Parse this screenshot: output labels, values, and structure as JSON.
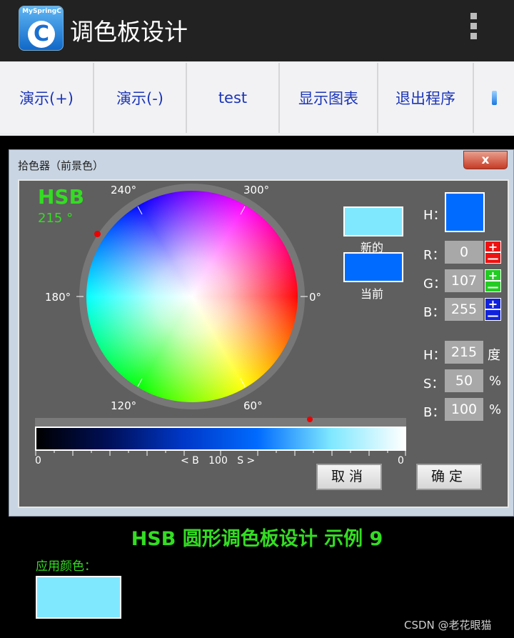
{
  "app": {
    "logo_text": "MySpringC",
    "logo_letter": "C",
    "title": "调色板设计",
    "overflow_icon": "overflow-menu-icon"
  },
  "toolbar": {
    "buttons": [
      "演示(+)",
      "演示(-)",
      "test",
      "显示图表",
      "退出程序"
    ]
  },
  "dialog": {
    "title": "拾色器（前景色）",
    "close_label": "x",
    "wheel": {
      "mode_label": "HSB",
      "hue_readout": "215 °",
      "angles": {
        "a240": "240°",
        "a300": "300°",
        "a180": "180°",
        "a0": "0°",
        "a120": "120°",
        "a60": "60°"
      }
    },
    "swatches": {
      "new_label": "新的",
      "current_label": "当前",
      "new_color": "#7fe8ff",
      "current_color": "#006bff"
    },
    "rgb": {
      "h_label": "H：",
      "r_label": "R：",
      "r_value": "0",
      "g_label": "G：",
      "g_value": "107",
      "b_label": "B：",
      "b_value": "255",
      "plus": "+",
      "minus": "—"
    },
    "hsb": {
      "h_label": "H：",
      "h_value": "215",
      "h_unit": "度",
      "s_label": "S：",
      "s_value": "50",
      "s_unit": "%",
      "b_label": "B：",
      "b_value": "100",
      "b_unit": "%"
    },
    "slider": {
      "left_label": "0",
      "right_label": "0",
      "center_label": "< B   100   S >",
      "position_fraction": 0.74
    },
    "cancel_label": "取消",
    "ok_label": "确定"
  },
  "footer": {
    "heading": "HSB 圆形调色板设计 示例 9",
    "apply_label": "应用颜色：",
    "apply_color": "#7fe8ff",
    "watermark": "CSDN @老花眼猫"
  },
  "colors": {
    "accent_green": "#33dd22",
    "link_blue": "#1b35b8"
  }
}
